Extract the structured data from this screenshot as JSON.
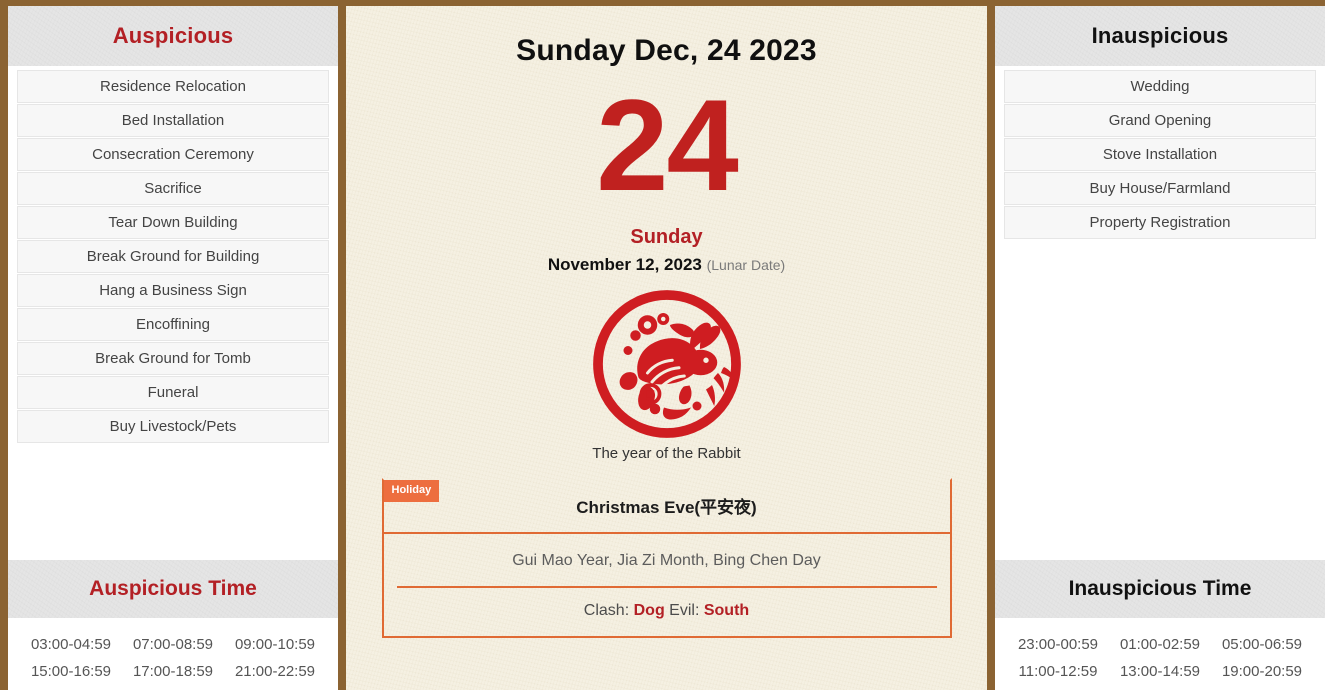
{
  "theme": {
    "frame_color": "#8B6332",
    "accent_red": "#b32025",
    "day_red": "#c0211f",
    "badge_orange": "#ed6e3f",
    "holiday_border": "#e06a34",
    "paper_cream": "#f4efe0",
    "header_gray": "#e4e4e4"
  },
  "left_panel": {
    "header": "Auspicious",
    "items": [
      "Residence Relocation",
      "Bed Installation",
      "Consecration Ceremony",
      "Sacrifice",
      "Tear Down Building",
      "Break Ground for Building",
      "Hang a Business Sign",
      "Encoffining",
      "Break Ground for Tomb",
      "Funeral",
      "Buy Livestock/Pets"
    ],
    "time_header": "Auspicious Time",
    "times": [
      "03:00-04:59",
      "07:00-08:59",
      "09:00-10:59",
      "15:00-16:59",
      "17:00-18:59",
      "21:00-22:59"
    ]
  },
  "right_panel": {
    "header": "Inauspicious",
    "items": [
      "Wedding",
      "Grand Opening",
      "Stove Installation",
      "Buy House/Farmland",
      "Property Registration"
    ],
    "time_header": "Inauspicious Time",
    "times": [
      "23:00-00:59",
      "01:00-02:59",
      "05:00-06:59",
      "11:00-12:59",
      "13:00-14:59",
      "19:00-20:59"
    ]
  },
  "center": {
    "full_date": "Sunday Dec, 24 2023",
    "day_number": "24",
    "weekday": "Sunday",
    "lunar_date": "November 12, 2023",
    "lunar_suffix": "(Lunar Date)",
    "zodiac_caption": "The year of the Rabbit",
    "zodiac_icon": "rabbit-papercut-icon",
    "holiday_badge": "Holiday",
    "holiday_title": "Christmas Eve(平安夜)",
    "ganzhi": "Gui Mao Year, Jia Zi Month, Bing Chen Day",
    "clash_prefix": "Clash:",
    "clash_value": "Dog",
    "evil_prefix": "Evil:",
    "evil_value": "South"
  }
}
